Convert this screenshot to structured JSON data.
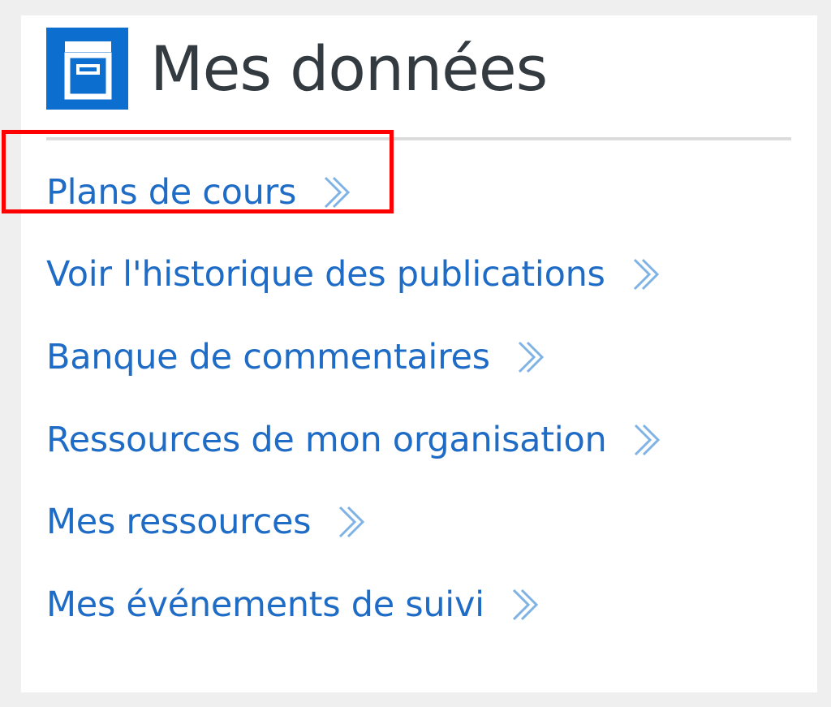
{
  "header": {
    "icon": "archive-box-icon",
    "title": "Mes données"
  },
  "menu": {
    "items": [
      {
        "label": "Plans de cours",
        "icon": "chevron-right-double-icon",
        "highlighted": true
      },
      {
        "label": "Voir l'historique des publications",
        "icon": "chevron-right-double-icon"
      },
      {
        "label": "Banque de commentaires",
        "icon": "chevron-right-double-icon"
      },
      {
        "label": "Ressources de mon organisation",
        "icon": "chevron-right-double-icon"
      },
      {
        "label": "Mes ressources",
        "icon": "chevron-right-double-icon"
      },
      {
        "label": "Mes événements de suivi",
        "icon": "chevron-right-double-icon"
      }
    ]
  },
  "colors": {
    "accent": "#0c6fd0",
    "link": "#1f6cc6",
    "title": "#333a40",
    "highlight_box": "#ff0000",
    "background": "#efefef",
    "panel": "#ffffff"
  }
}
